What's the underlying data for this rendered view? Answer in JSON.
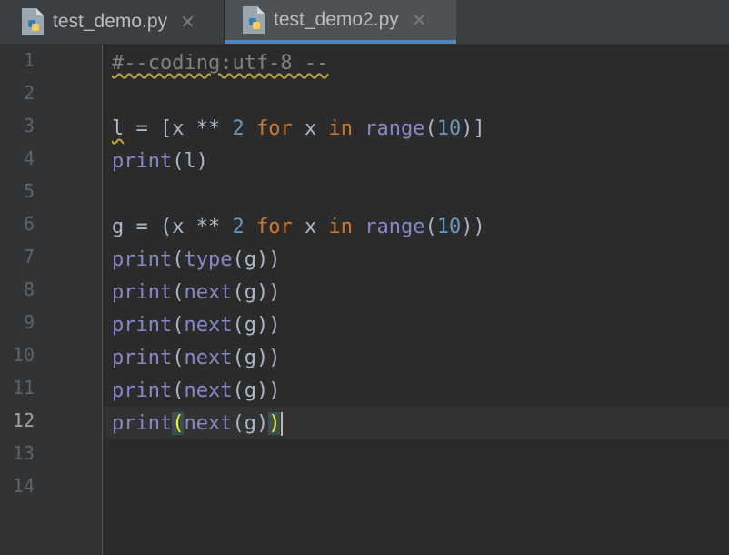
{
  "tabs": [
    {
      "label": "test_demo.py",
      "icon": "python-file-icon",
      "active": false
    },
    {
      "label": "test_demo2.py",
      "icon": "python-file-icon",
      "active": true
    }
  ],
  "editor": {
    "current_line": 12,
    "line_numbers": [
      "1",
      "2",
      "3",
      "4",
      "5",
      "6",
      "7",
      "8",
      "9",
      "10",
      "11",
      "12",
      "13",
      "14"
    ],
    "lines": [
      "#--coding:utf-8 --",
      "",
      "l = [x ** 2 for x in range(10)]",
      "print(l)",
      "",
      "g = (x ** 2 for x in range(10))",
      "print(type(g))",
      "print(next(g))",
      "print(next(g))",
      "print(next(g))",
      "print(next(g))",
      "print(next(g))",
      "",
      ""
    ]
  },
  "colors": {
    "background": "#2b2b2b",
    "tab_active_underline": "#4a88c7",
    "keyword": "#cc7832",
    "builtin": "#8888c6",
    "number": "#6897bb",
    "comment": "#808080"
  }
}
